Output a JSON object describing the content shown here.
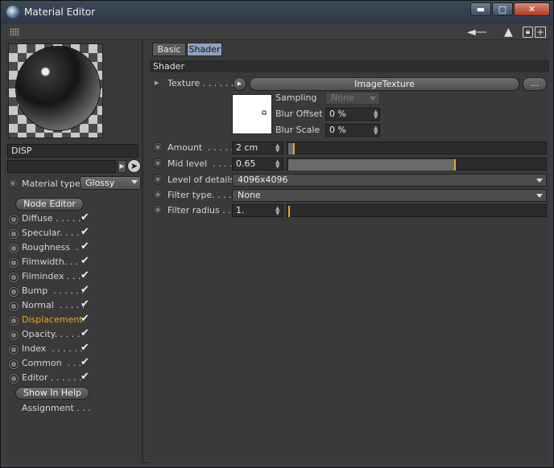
{
  "window": {
    "title": "Material Editor",
    "minimize": "▬",
    "maximize": "□",
    "close": "✕"
  },
  "toolbar": {
    "icons": [
      "grip-icon",
      "navigate-back-icon",
      "navigate-up-icon",
      "lock-icon",
      "new-view-icon"
    ]
  },
  "left_panel": {
    "material_name": "DISP",
    "material_type_label": "Material type",
    "material_type_value": "Glossy",
    "node_editor_label": "Node Editor",
    "channels": [
      {
        "label": "Diffuse . . . . .",
        "checked": true
      },
      {
        "label": "Specular. . . .",
        "checked": true
      },
      {
        "label": "Roughness  .",
        "checked": true
      },
      {
        "label": "Filmwidth. . .",
        "checked": true
      },
      {
        "label": "Filmindex . . .",
        "checked": true
      },
      {
        "label": "Bump  . . . . . .",
        "checked": true
      },
      {
        "label": "Normal  . . . . .",
        "checked": true
      },
      {
        "label": "Displacement",
        "checked": true,
        "active": true
      },
      {
        "label": "Opacity. . . . .",
        "checked": true
      },
      {
        "label": "Index  . . . . . .",
        "checked": true
      },
      {
        "label": "Common  . . .",
        "checked": true
      },
      {
        "label": "Editor . . . . . .",
        "checked": true
      }
    ],
    "check_glyph": "✔",
    "show_in_help_label": "Show In Help",
    "assignment_label": "Assignment . . ."
  },
  "tabs": {
    "basic": "Basic",
    "shader": "Shader",
    "active": "Shader"
  },
  "shader": {
    "section_title": "Shader",
    "texture_label": "Texture . . . . . .",
    "texture_value": "ImageTexture",
    "texture_more": "...",
    "sampling_label": "Sampling",
    "sampling_value": "None",
    "blur_offset_label": "Blur Offset",
    "blur_offset_value": "0 %",
    "blur_scale_label": "Blur Scale",
    "blur_scale_value": "0 %",
    "amount_label": "Amount  . . . . .",
    "amount_value": "2 cm",
    "amount_fraction": 0.02,
    "mid_level_label": "Mid level  . . . .",
    "mid_level_value": "0.65",
    "mid_level_fraction": 0.65,
    "level_of_details_label": "Level of details",
    "level_of_details_value": "4096x4096",
    "filter_type_label": "Filter type. . . .",
    "filter_type_value": "None",
    "filter_radius_label": "Filter radius . .",
    "filter_radius_value": "1.",
    "filter_radius_fraction": 0.0
  },
  "colors": {
    "accent": "#f0a228",
    "active_tab": "#8ea2c0",
    "panel": "#3a3a3a"
  }
}
